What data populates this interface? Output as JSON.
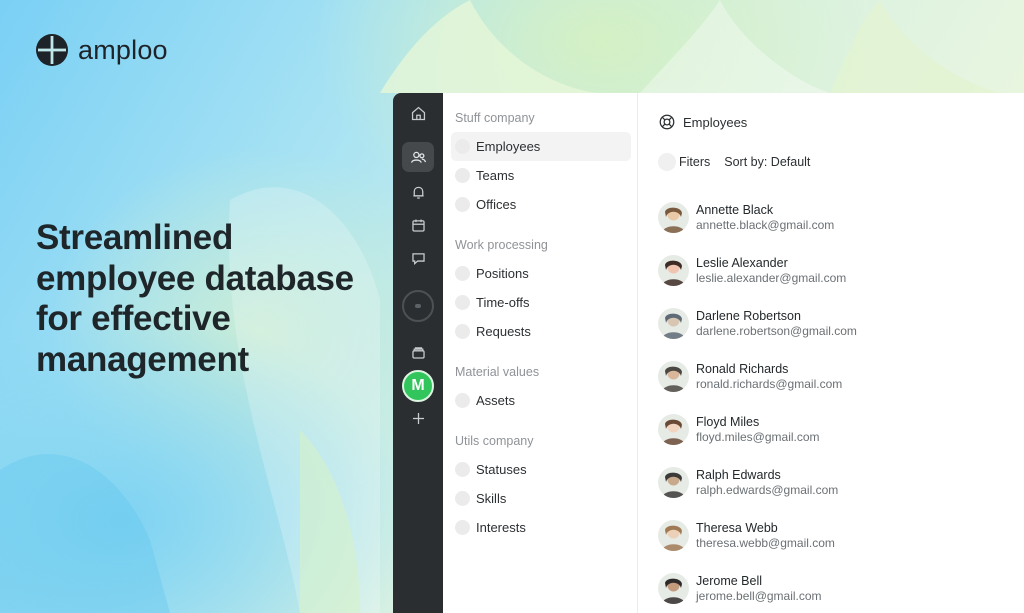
{
  "brand": {
    "name": "amploo"
  },
  "headline": "Streamlined employee database for effective management",
  "rail": {
    "icons": [
      "home-icon",
      "users-icon",
      "bell-icon",
      "calendar-icon",
      "chat-icon",
      "progress-ring-icon",
      "archive-icon",
      "plus-icon"
    ],
    "workspace_initial": "M",
    "accent_color": "#32c55b"
  },
  "sidebar": {
    "sections": [
      {
        "title": "Stuff company",
        "items": [
          "Employees",
          "Teams",
          "Offices"
        ]
      },
      {
        "title": "Work processing",
        "items": [
          "Positions",
          "Time-offs",
          "Requests"
        ]
      },
      {
        "title": "Material values",
        "items": [
          "Assets"
        ]
      },
      {
        "title": "Utils company",
        "items": [
          "Statuses",
          "Skills",
          "Interests"
        ]
      }
    ],
    "active_item": "Employees"
  },
  "main": {
    "title": "Employees",
    "filters_label": "Fiters",
    "sort_label": "Sort by: Default",
    "employees": [
      {
        "name": "Annette Black",
        "email": "annette.black@gmail.com"
      },
      {
        "name": "Leslie Alexander",
        "email": "leslie.alexander@gmail.com"
      },
      {
        "name": "Darlene Robertson",
        "email": "darlene.robertson@gmail.com"
      },
      {
        "name": "Ronald Richards",
        "email": "ronald.richards@gmail.com"
      },
      {
        "name": "Floyd Miles",
        "email": "floyd.miles@gmail.com"
      },
      {
        "name": "Ralph Edwards",
        "email": "ralph.edwards@gmail.com"
      },
      {
        "name": "Theresa Webb",
        "email": "theresa.webb@gmail.com"
      },
      {
        "name": "Jerome Bell",
        "email": "jerome.bell@gmail.com"
      }
    ]
  }
}
